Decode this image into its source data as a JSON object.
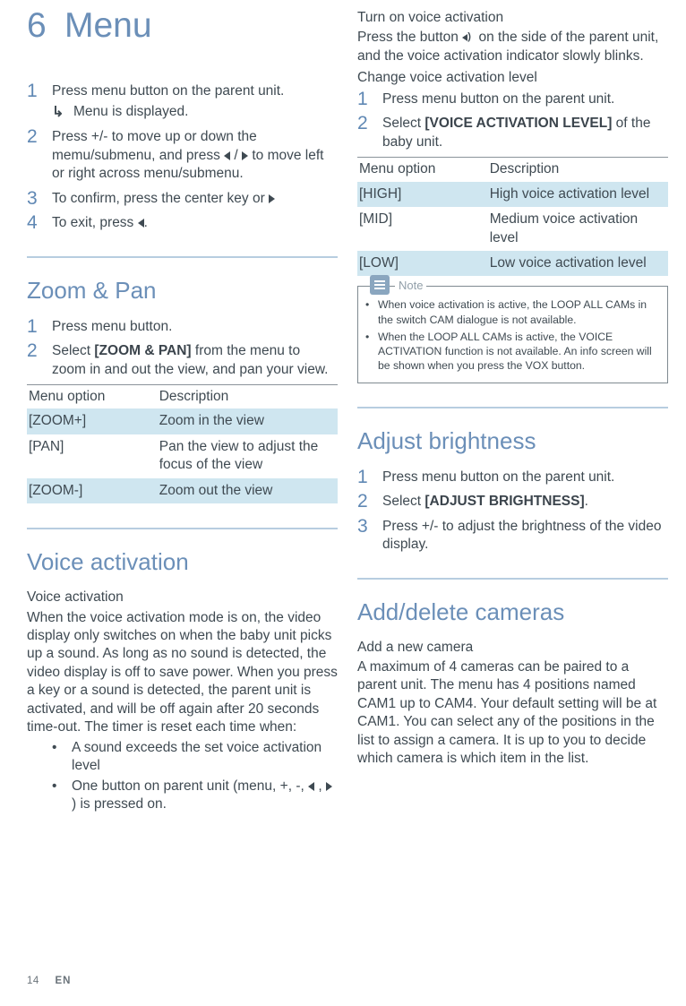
{
  "page": {
    "number": "14",
    "lang": "EN"
  },
  "chapter": {
    "num": "6",
    "title": "Menu"
  },
  "main_steps": [
    {
      "num": "1",
      "text": "Press menu button on the parent unit.",
      "result": "Menu is displayed."
    },
    {
      "num": "2",
      "text_a": "Press +/- to move up or down the memu/submenu, and press ",
      "text_b": " / ",
      "text_c": " to move left or right across menu/submenu."
    },
    {
      "num": "3",
      "text_a": "To confirm, press the center key or "
    },
    {
      "num": "4",
      "text_a": "To exit, press ",
      "text_b": "."
    }
  ],
  "zoom": {
    "heading": "Zoom & Pan",
    "steps": [
      {
        "num": "1",
        "text": "Press menu button."
      },
      {
        "num": "2",
        "text_a": "Select ",
        "bold": "[ZOOM & PAN]",
        "text_b": " from the menu to zoom in and out the view, and pan your view."
      }
    ],
    "table_head": {
      "a": "Menu option",
      "b": "Description"
    },
    "rows": [
      {
        "a": "[ZOOM+]",
        "b": "Zoom in the view",
        "shade": true
      },
      {
        "a": "[PAN]",
        "b": "Pan the view to adjust the focus of the view",
        "shade": false
      },
      {
        "a": "[ZOOM-]",
        "b": "Zoom out the view",
        "shade": true
      }
    ]
  },
  "voice": {
    "heading": "Voice activation",
    "sub": "Voice activation",
    "para": "When the voice activation mode is on, the video display only switches on when the baby unit picks up a sound. As long as no sound is detected, the video display is off to save power. When you press a key or a sound is detected, the parent unit is activated, and will be off again after 20 seconds time-out. The timer is reset each time when:",
    "bullets": [
      "A sound exceeds the set voice activation level",
      "One button on parent unit (menu, +, -, "
    ],
    "bullets_tail": " ) is pressed on."
  },
  "turnon": {
    "sub": "Turn on voice activation",
    "text_a": "Press the button ",
    "text_b": " on the side of the parent unit, and the voice activation indicator slowly blinks.",
    "change_sub": "Change voice activation level",
    "steps": [
      {
        "num": "1",
        "text": "Press menu button on the parent unit."
      },
      {
        "num": "2",
        "text_a": "Select ",
        "bold": "[VOICE ACTIVATION LEVEL]",
        "text_b": " of the baby unit."
      }
    ],
    "table_head": {
      "a": "Menu option",
      "b": "Description"
    },
    "rows": [
      {
        "a": "[HIGH]",
        "b": "High voice activation level",
        "shade": true
      },
      {
        "a": "[MID]",
        "b": "Medium voice activation level",
        "shade": false
      },
      {
        "a": "[LOW]",
        "b": "Low voice activation level",
        "shade": true
      }
    ]
  },
  "note": {
    "label": "Note",
    "items": [
      "When voice activation is active, the LOOP ALL CAMs in the switch CAM dialogue is not available.",
      "When the LOOP ALL CAMs is active, the VOICE ACTIVATION function is not available. An info screen will be shown when you press the VOX button."
    ]
  },
  "bright": {
    "heading": "Adjust brightness",
    "steps": [
      {
        "num": "1",
        "text": "Press menu button on the parent unit."
      },
      {
        "num": "2",
        "text_a": "Select ",
        "bold": "[ADJUST BRIGHTNESS]",
        "text_b": "."
      },
      {
        "num": "3",
        "text": "Press +/- to adjust the brightness of the video display."
      }
    ]
  },
  "cams": {
    "heading": "Add/delete cameras",
    "sub": "Add a new camera",
    "para": "A maximum of 4 cameras can be paired to a parent unit. The menu has 4 positions named CAM1 up to CAM4. Your default setting will be at CAM1. You can select any of the positions in the list to assign a camera. It is up to you to decide which camera is which item in the list."
  }
}
